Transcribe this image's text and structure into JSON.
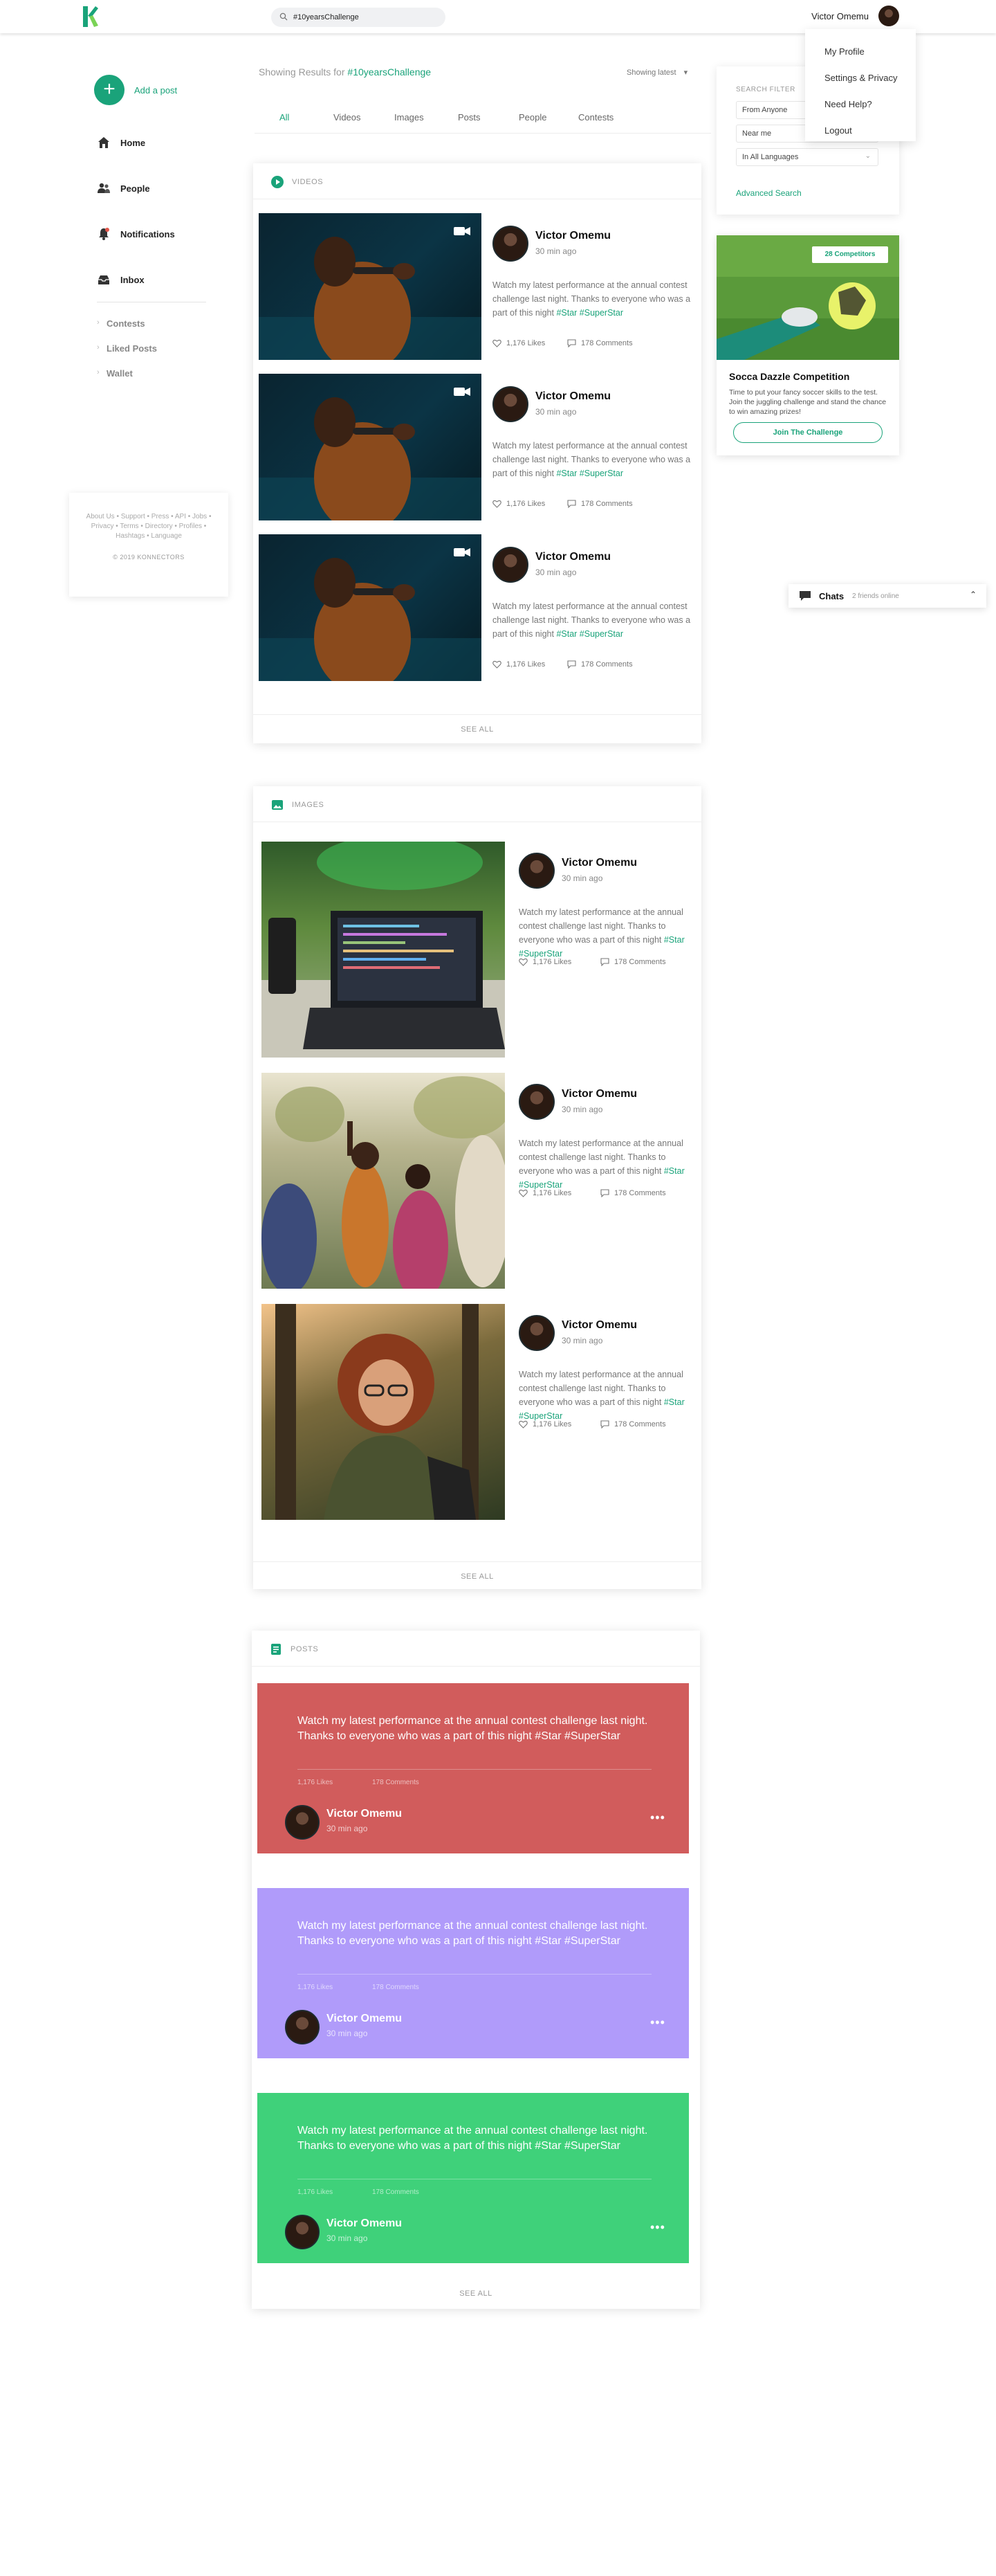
{
  "header": {
    "search_value": "#10yearsChallenge",
    "user_name": "Victor Omemu",
    "menu": [
      "My Profile",
      "Settings & Privacy",
      "Need Help?",
      "Logout"
    ]
  },
  "sidebar": {
    "add_post": "Add a post",
    "items": [
      {
        "label": "Home",
        "icon": "home-icon"
      },
      {
        "label": "People",
        "icon": "people-icon"
      },
      {
        "label": "Notifications",
        "icon": "bell-icon"
      },
      {
        "label": "Inbox",
        "icon": "inbox-icon"
      }
    ],
    "sub_items": [
      "Contests",
      "Liked Posts",
      "Wallet"
    ],
    "footer_links": "About Us • Support • Press • API • Jobs • Privacy • Terms • Directory • Profiles • Hashtags • Language",
    "copyright": "© 2019 KONNECTORS"
  },
  "results": {
    "prefix": "Showing Results for",
    "tag": "#10yearsChallenge",
    "sort": "Showing latest"
  },
  "tabs": [
    "All",
    "Videos",
    "Images",
    "Posts",
    "People",
    "Contests"
  ],
  "videos": {
    "title": "VIDEOS",
    "see_all": "SEE ALL",
    "items": [
      {
        "name": "Victor Omemu",
        "time": "30 min ago",
        "text": "Watch my latest performance at the annual contest challenge last night. Thanks to everyone who was a part of this night",
        "tags": "#Star #SuperStar",
        "likes": "1,176 Likes",
        "comments": "178 Comments"
      },
      {
        "name": "Victor Omemu",
        "time": "30 min ago",
        "text": "Watch my latest performance at the annual contest challenge last night. Thanks to everyone who was a part of this night",
        "tags": "#Star #SuperStar",
        "likes": "1,176 Likes",
        "comments": "178 Comments"
      },
      {
        "name": "Victor Omemu",
        "time": "30 min ago",
        "text": "Watch my latest performance at the annual contest challenge last night. Thanks to everyone who was a part of this night",
        "tags": "#Star #SuperStar",
        "likes": "1,176 Likes",
        "comments": "178 Comments"
      }
    ]
  },
  "images": {
    "title": "IMAGES",
    "see_all": "SEE ALL",
    "items": [
      {
        "name": "Victor Omemu",
        "time": "30 min ago",
        "text": "Watch my latest performance at the annual contest challenge last night. Thanks to everyone who was a part of this night",
        "tags": "#Star #SuperStar",
        "likes": "1,176 Likes",
        "comments": "178 Comments"
      },
      {
        "name": "Victor Omemu",
        "time": "30 min ago",
        "text": "Watch my latest performance at the annual contest challenge last night. Thanks to everyone who was a part of this night",
        "tags": "#Star #SuperStar",
        "likes": "1,176 Likes",
        "comments": "178 Comments"
      },
      {
        "name": "Victor Omemu",
        "time": "30 min ago",
        "text": "Watch my latest performance at the annual contest challenge last night. Thanks to everyone who was a part of this night",
        "tags": "#Star #SuperStar",
        "likes": "1,176 Likes",
        "comments": "178 Comments"
      }
    ]
  },
  "posts": {
    "title": "POSTS",
    "see_all": "SEE ALL",
    "items": [
      {
        "color": "#d15c5c",
        "text": "Watch my latest performance at the annual contest challenge last night. Thanks to everyone who was a part of this night #Star #SuperStar",
        "likes": "1,176 Likes",
        "comments": "178 Comments",
        "name": "Victor Omemu",
        "time": "30 min ago"
      },
      {
        "color": "#b09bfa",
        "text": "Watch my latest performance at the annual contest challenge last night. Thanks to everyone who was a part of this night #Star #SuperStar",
        "likes": "1,176 Likes",
        "comments": "178 Comments",
        "name": "Victor Omemu",
        "time": "30 min ago"
      },
      {
        "color": "#3fd17a",
        "text": "Watch my latest performance at the annual contest challenge last night. Thanks to everyone who was a part of this night #Star #SuperStar",
        "likes": "1,176 Likes",
        "comments": "178 Comments",
        "name": "Victor Omemu",
        "time": "30 min ago"
      }
    ]
  },
  "filter": {
    "title": "SEARCH FILTER",
    "selects": [
      "From Anyone",
      "Near me",
      "In All Languages"
    ],
    "advanced": "Advanced Search"
  },
  "promo": {
    "badge": "28 Competitors",
    "title": "Socca Dazzle Competition",
    "text": "Time to put your fancy soccer skills to the test. Join the juggling challenge and stand the chance to win amazing prizes!",
    "button": "Join The Challenge"
  },
  "chats": {
    "title": "Chats",
    "subtitle": "2 friends online"
  },
  "colors": {
    "accent": "#1aa37a"
  }
}
